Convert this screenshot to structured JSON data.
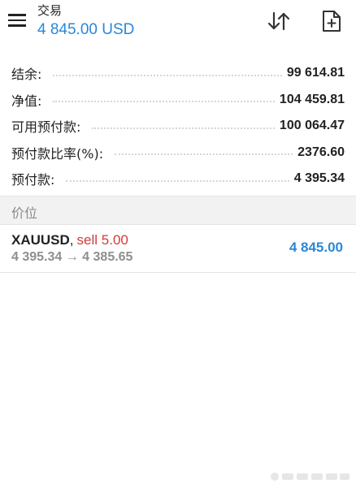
{
  "header": {
    "title": "交易",
    "balance": "4 845.00 USD",
    "menu_icon": "hamburger-menu-icon",
    "sort_icon": "sort-arrows-icon",
    "new_order_icon": "document-add-icon"
  },
  "summary": [
    {
      "label": "结余:",
      "value": "99 614.81"
    },
    {
      "label": "净值:",
      "value": "104 459.81"
    },
    {
      "label": "可用预付款:",
      "value": "100 064.47"
    },
    {
      "label": "预付款比率(%):",
      "value": "2376.60"
    },
    {
      "label": "预付款:",
      "value": "4 395.34"
    }
  ],
  "positions_section": {
    "label": "价位"
  },
  "position": {
    "symbol": "XAUUSD",
    "comma": ",",
    "side": "sell 5.00",
    "prices": "4 395.34 → 4 385.65",
    "profit": "4 845.00"
  },
  "colors": {
    "accent_blue": "#2a87d8",
    "sell_red": "#d23a3a",
    "muted_gray": "#8e8e8e",
    "section_bg": "#f2f2f2"
  }
}
